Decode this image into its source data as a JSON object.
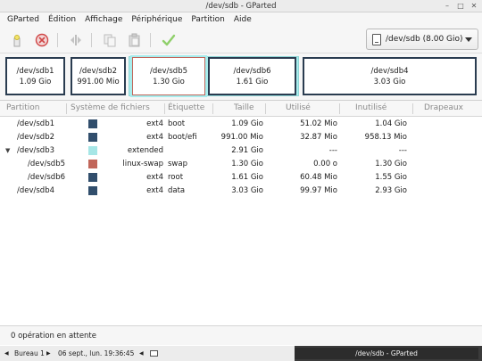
{
  "window": {
    "title": "/dev/sdb - GParted"
  },
  "menu": [
    "GParted",
    "Édition",
    "Affichage",
    "Périphérique",
    "Partition",
    "Aide"
  ],
  "toolbar": {
    "buttons": [
      "new-partition",
      "delete-partition",
      "resize-move",
      "copy",
      "paste",
      "apply"
    ]
  },
  "device_selector": {
    "label": "/dev/sdb (8.00 Gio)"
  },
  "map": [
    {
      "name": "/dev/sdb1",
      "size": "1.09 Gio"
    },
    {
      "name": "/dev/sdb2",
      "size": "991.00 Mio"
    },
    {
      "name": "/dev/sdb5",
      "size": "1.30 Gio"
    },
    {
      "name": "/dev/sdb6",
      "size": "1.61 Gio"
    },
    {
      "name": "/dev/sdb4",
      "size": "3.03 Gio"
    }
  ],
  "table": {
    "headers": [
      "Partition",
      "Système de fichiers",
      "Étiquette",
      "Taille",
      "Utilisé",
      "Inutilisé",
      "Drapeaux"
    ],
    "rows": [
      {
        "partition": "/dev/sdb1",
        "color": "#314e6c",
        "fs": "ext4",
        "label": "boot",
        "size": "1.09 Gio",
        "used": "51.02 Mio",
        "unused": "1.04 Gio",
        "flags": ""
      },
      {
        "partition": "/dev/sdb2",
        "color": "#314e6c",
        "fs": "ext4",
        "label": "boot/efi",
        "size": "991.00 Mio",
        "used": "32.87 Mio",
        "unused": "958.13 Mio",
        "flags": ""
      },
      {
        "partition": "/dev/sdb3",
        "color": "#a6e6e6",
        "fs": "extended",
        "label": "",
        "size": "2.91 Gio",
        "used": "---",
        "unused": "---",
        "flags": ""
      },
      {
        "partition": "/dev/sdb5",
        "color": "#c1665a",
        "fs": "linux-swap",
        "label": "swap",
        "size": "1.30 Gio",
        "used": "0.00 o",
        "unused": "1.30 Gio",
        "flags": ""
      },
      {
        "partition": "/dev/sdb6",
        "color": "#314e6c",
        "fs": "ext4",
        "label": "root",
        "size": "1.61 Gio",
        "used": "60.48 Mio",
        "unused": "1.55 Gio",
        "flags": ""
      },
      {
        "partition": "/dev/sdb4",
        "color": "#314e6c",
        "fs": "ext4",
        "label": "data",
        "size": "3.03 Gio",
        "used": "99.97 Mio",
        "unused": "2.93 Gio",
        "flags": ""
      }
    ]
  },
  "status": "0 opération en attente",
  "taskbar": {
    "desktop": "Bureau 1",
    "datetime": "06 sept., lun. 19:36:45",
    "window": "/dev/sdb - GParted"
  }
}
